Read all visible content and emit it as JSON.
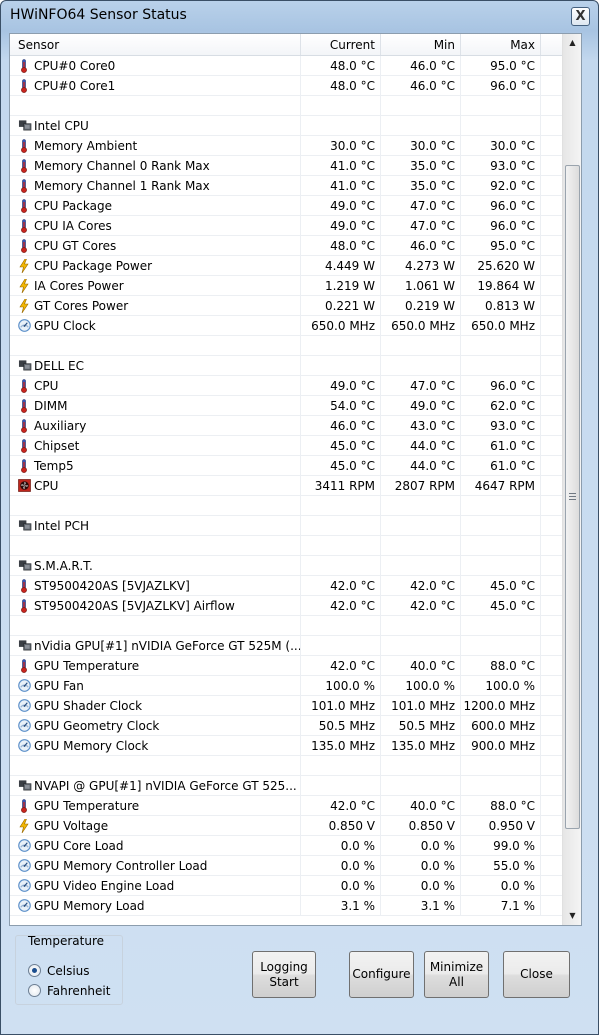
{
  "window": {
    "title": "HWiNFO64 Sensor Status",
    "close_label": "X"
  },
  "columns": {
    "sensor": "Sensor",
    "current": "Current",
    "min": "Min",
    "max": "Max"
  },
  "rows": [
    {
      "icon": "thermometer",
      "sensor": "CPU#0 Core0",
      "current": "48.0 °C",
      "min": "46.0 °C",
      "max": "95.0 °C"
    },
    {
      "icon": "thermometer",
      "sensor": "CPU#0 Core1",
      "current": "48.0 °C",
      "min": "46.0 °C",
      "max": "96.0 °C"
    },
    {
      "icon": "",
      "sensor": "",
      "current": "",
      "min": "",
      "max": ""
    },
    {
      "icon": "chip",
      "sensor": "Intel CPU",
      "current": "",
      "min": "",
      "max": ""
    },
    {
      "icon": "thermometer",
      "sensor": "Memory Ambient",
      "current": "30.0 °C",
      "min": "30.0 °C",
      "max": "30.0 °C"
    },
    {
      "icon": "thermometer",
      "sensor": "Memory Channel 0 Rank Max",
      "current": "41.0 °C",
      "min": "35.0 °C",
      "max": "93.0 °C"
    },
    {
      "icon": "thermometer",
      "sensor": "Memory Channel 1 Rank Max",
      "current": "41.0 °C",
      "min": "35.0 °C",
      "max": "92.0 °C"
    },
    {
      "icon": "thermometer",
      "sensor": "CPU Package",
      "current": "49.0 °C",
      "min": "47.0 °C",
      "max": "96.0 °C"
    },
    {
      "icon": "thermometer",
      "sensor": "CPU IA Cores",
      "current": "49.0 °C",
      "min": "47.0 °C",
      "max": "96.0 °C"
    },
    {
      "icon": "thermometer",
      "sensor": "CPU GT Cores",
      "current": "48.0 °C",
      "min": "46.0 °C",
      "max": "95.0 °C"
    },
    {
      "icon": "bolt",
      "sensor": "CPU Package Power",
      "current": "4.449 W",
      "min": "4.273 W",
      "max": "25.620 W"
    },
    {
      "icon": "bolt",
      "sensor": "IA Cores Power",
      "current": "1.219 W",
      "min": "1.061 W",
      "max": "19.864 W"
    },
    {
      "icon": "bolt",
      "sensor": "GT Cores Power",
      "current": "0.221 W",
      "min": "0.219 W",
      "max": "0.813 W"
    },
    {
      "icon": "gauge",
      "sensor": "GPU Clock",
      "current": "650.0 MHz",
      "min": "650.0 MHz",
      "max": "650.0 MHz"
    },
    {
      "icon": "",
      "sensor": "",
      "current": "",
      "min": "",
      "max": ""
    },
    {
      "icon": "chip",
      "sensor": "DELL EC",
      "current": "",
      "min": "",
      "max": ""
    },
    {
      "icon": "thermometer",
      "sensor": "CPU",
      "current": "49.0 °C",
      "min": "47.0 °C",
      "max": "96.0 °C"
    },
    {
      "icon": "thermometer",
      "sensor": "DIMM",
      "current": "54.0 °C",
      "min": "49.0 °C",
      "max": "62.0 °C"
    },
    {
      "icon": "thermometer",
      "sensor": "Auxiliary",
      "current": "46.0 °C",
      "min": "43.0 °C",
      "max": "93.0 °C"
    },
    {
      "icon": "thermometer",
      "sensor": "Chipset",
      "current": "45.0 °C",
      "min": "44.0 °C",
      "max": "61.0 °C"
    },
    {
      "icon": "thermometer",
      "sensor": "Temp5",
      "current": "45.0 °C",
      "min": "44.0 °C",
      "max": "61.0 °C"
    },
    {
      "icon": "fan",
      "sensor": "CPU",
      "current": "3411 RPM",
      "min": "2807 RPM",
      "max": "4647 RPM"
    },
    {
      "icon": "",
      "sensor": "",
      "current": "",
      "min": "",
      "max": ""
    },
    {
      "icon": "chip",
      "sensor": "Intel PCH",
      "current": "",
      "min": "",
      "max": ""
    },
    {
      "icon": "",
      "sensor": "",
      "current": "",
      "min": "",
      "max": ""
    },
    {
      "icon": "chip",
      "sensor": "S.M.A.R.T.",
      "current": "",
      "min": "",
      "max": ""
    },
    {
      "icon": "thermometer",
      "sensor": "ST9500420AS [5VJAZLKV]",
      "current": "42.0 °C",
      "min": "42.0 °C",
      "max": "45.0 °C"
    },
    {
      "icon": "thermometer",
      "sensor": "ST9500420AS [5VJAZLKV] Airflow",
      "current": "42.0 °C",
      "min": "42.0 °C",
      "max": "45.0 °C"
    },
    {
      "icon": "",
      "sensor": "",
      "current": "",
      "min": "",
      "max": ""
    },
    {
      "icon": "chip",
      "sensor": "nVidia GPU[#1] nVIDIA GeForce GT 525M (...",
      "current": "",
      "min": "",
      "max": ""
    },
    {
      "icon": "thermometer",
      "sensor": "GPU Temperature",
      "current": "42.0 °C",
      "min": "40.0 °C",
      "max": "88.0 °C"
    },
    {
      "icon": "gauge",
      "sensor": "GPU Fan",
      "current": "100.0 %",
      "min": "100.0 %",
      "max": "100.0 %"
    },
    {
      "icon": "gauge",
      "sensor": "GPU Shader Clock",
      "current": "101.0 MHz",
      "min": "101.0 MHz",
      "max": "1200.0 MHz"
    },
    {
      "icon": "gauge",
      "sensor": "GPU Geometry Clock",
      "current": "50.5 MHz",
      "min": "50.5 MHz",
      "max": "600.0 MHz"
    },
    {
      "icon": "gauge",
      "sensor": "GPU Memory Clock",
      "current": "135.0 MHz",
      "min": "135.0 MHz",
      "max": "900.0 MHz"
    },
    {
      "icon": "",
      "sensor": "",
      "current": "",
      "min": "",
      "max": ""
    },
    {
      "icon": "chip",
      "sensor": "NVAPI @ GPU[#1] nVIDIA GeForce GT 525...",
      "current": "",
      "min": "",
      "max": ""
    },
    {
      "icon": "thermometer",
      "sensor": "GPU Temperature",
      "current": "42.0 °C",
      "min": "40.0 °C",
      "max": "88.0 °C"
    },
    {
      "icon": "bolt",
      "sensor": "GPU Voltage",
      "current": "0.850 V",
      "min": "0.850 V",
      "max": "0.950 V"
    },
    {
      "icon": "gauge",
      "sensor": "GPU Core Load",
      "current": "0.0 %",
      "min": "0.0 %",
      "max": "99.0 %"
    },
    {
      "icon": "gauge",
      "sensor": "GPU Memory Controller Load",
      "current": "0.0 %",
      "min": "0.0 %",
      "max": "55.0 %"
    },
    {
      "icon": "gauge",
      "sensor": "GPU Video Engine Load",
      "current": "0.0 %",
      "min": "0.0 %",
      "max": "0.0 %"
    },
    {
      "icon": "gauge",
      "sensor": "GPU Memory Load",
      "current": "3.1 %",
      "min": "3.1 %",
      "max": "7.1 %"
    }
  ],
  "temperature": {
    "label": "Temperature",
    "options": [
      {
        "label": "Celsius",
        "checked": true
      },
      {
        "label": "Fahrenheit",
        "checked": false
      }
    ]
  },
  "buttons": {
    "logging": "Logging\nStart",
    "configure": "Configure",
    "minimize": "Minimize\nAll",
    "close": "Close"
  },
  "colors": {
    "thermometer_red": "#c8251e",
    "thermometer_blue": "#3755b7",
    "bolt_yellow": "#f2b705",
    "gauge_blue": "#5b8fc9",
    "chip_dark": "#3a3f45",
    "fan_red": "#c0261d"
  }
}
